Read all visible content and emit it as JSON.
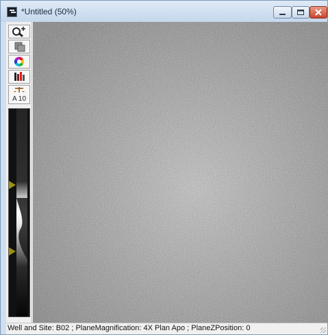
{
  "window": {
    "title": "*Untitled (50%)",
    "app_icon": "metamorph-app-icon",
    "controls": {
      "minimize": "minimize-icon",
      "maximize": "maximize-icon",
      "close": "close-icon"
    }
  },
  "toolbar": {
    "tools": [
      {
        "name": "zoom-tool",
        "icon": "magnifier-zoom-icon"
      },
      {
        "name": "copy-tool",
        "icon": "copy-icon"
      },
      {
        "name": "color-tool",
        "icon": "color-wheel-icon"
      },
      {
        "name": "lut-tool",
        "icon": "lookup-table-icon"
      },
      {
        "name": "scale-tool",
        "icon": "autoscale-icon",
        "label": "A 10"
      }
    ]
  },
  "lut_display": {
    "markers": [
      "top-threshold-marker",
      "bottom-threshold-marker"
    ],
    "colors": {
      "marker": "#9c9111"
    }
  },
  "image": {
    "description_icon": "noise-image",
    "colors": {
      "base": "#9c9c9c"
    }
  },
  "status_bar": {
    "text": "Well and Site: B02 ; PlaneMagnification: 4X Plan Apo ; PlaneZPosition: 0"
  }
}
